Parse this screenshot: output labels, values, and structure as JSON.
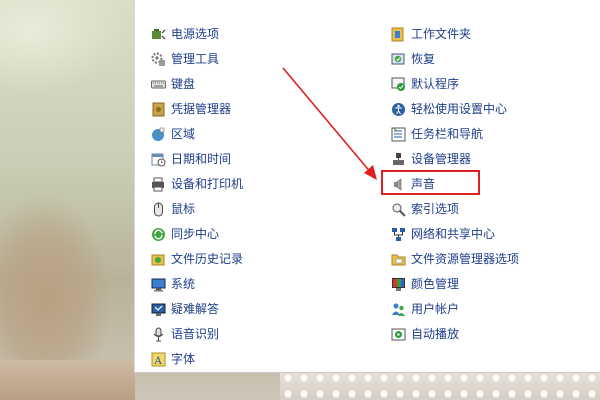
{
  "left_column": [
    {
      "key": "power",
      "label": "电源选项",
      "icon": "power-options-icon"
    },
    {
      "key": "admin-tools",
      "label": "管理工具",
      "icon": "admin-tools-icon"
    },
    {
      "key": "keyboard",
      "label": "键盘",
      "icon": "keyboard-icon"
    },
    {
      "key": "credential",
      "label": "凭据管理器",
      "icon": "credential-manager-icon"
    },
    {
      "key": "region",
      "label": "区域",
      "icon": "region-globe-icon"
    },
    {
      "key": "datetime",
      "label": "日期和时间",
      "icon": "date-time-icon"
    },
    {
      "key": "devices-printers",
      "label": "设备和打印机",
      "icon": "printer-icon"
    },
    {
      "key": "mouse",
      "label": "鼠标",
      "icon": "mouse-icon"
    },
    {
      "key": "sync",
      "label": "同步中心",
      "icon": "sync-icon"
    },
    {
      "key": "file-history",
      "label": "文件历史记录",
      "icon": "file-history-icon"
    },
    {
      "key": "system",
      "label": "系统",
      "icon": "system-icon"
    },
    {
      "key": "troubleshoot",
      "label": "疑难解答",
      "icon": "troubleshooting-icon"
    },
    {
      "key": "speech",
      "label": "语音识别",
      "icon": "microphone-icon"
    },
    {
      "key": "fonts",
      "label": "字体",
      "icon": "font-icon"
    }
  ],
  "right_column": [
    {
      "key": "work-folders",
      "label": "工作文件夹",
      "icon": "work-folders-icon"
    },
    {
      "key": "recovery",
      "label": "恢复",
      "icon": "recovery-icon"
    },
    {
      "key": "default-programs",
      "label": "默认程序",
      "icon": "default-programs-icon"
    },
    {
      "key": "ease-of-access",
      "label": "轻松使用设置中心",
      "icon": "ease-of-access-icon"
    },
    {
      "key": "taskbar",
      "label": "任务栏和导航",
      "icon": "taskbar-icon"
    },
    {
      "key": "device-manager",
      "label": "设备管理器",
      "icon": "device-manager-icon"
    },
    {
      "key": "sound",
      "label": "声音",
      "icon": "speaker-icon"
    },
    {
      "key": "indexing",
      "label": "索引选项",
      "icon": "indexing-icon"
    },
    {
      "key": "network",
      "label": "网络和共享中心",
      "icon": "network-icon"
    },
    {
      "key": "explorer-options",
      "label": "文件资源管理器选项",
      "icon": "folder-options-icon"
    },
    {
      "key": "color",
      "label": "颜色管理",
      "icon": "color-management-icon"
    },
    {
      "key": "user-accounts",
      "label": "用户帐户",
      "icon": "user-accounts-icon"
    },
    {
      "key": "autoplay",
      "label": "自动播放",
      "icon": "autoplay-icon"
    }
  ],
  "annotation": {
    "highlight_color": "#e02020",
    "highlighted_item": "声音"
  },
  "colors": {
    "link_text": "#1e3e8a",
    "window_bg": "#ffffff"
  }
}
